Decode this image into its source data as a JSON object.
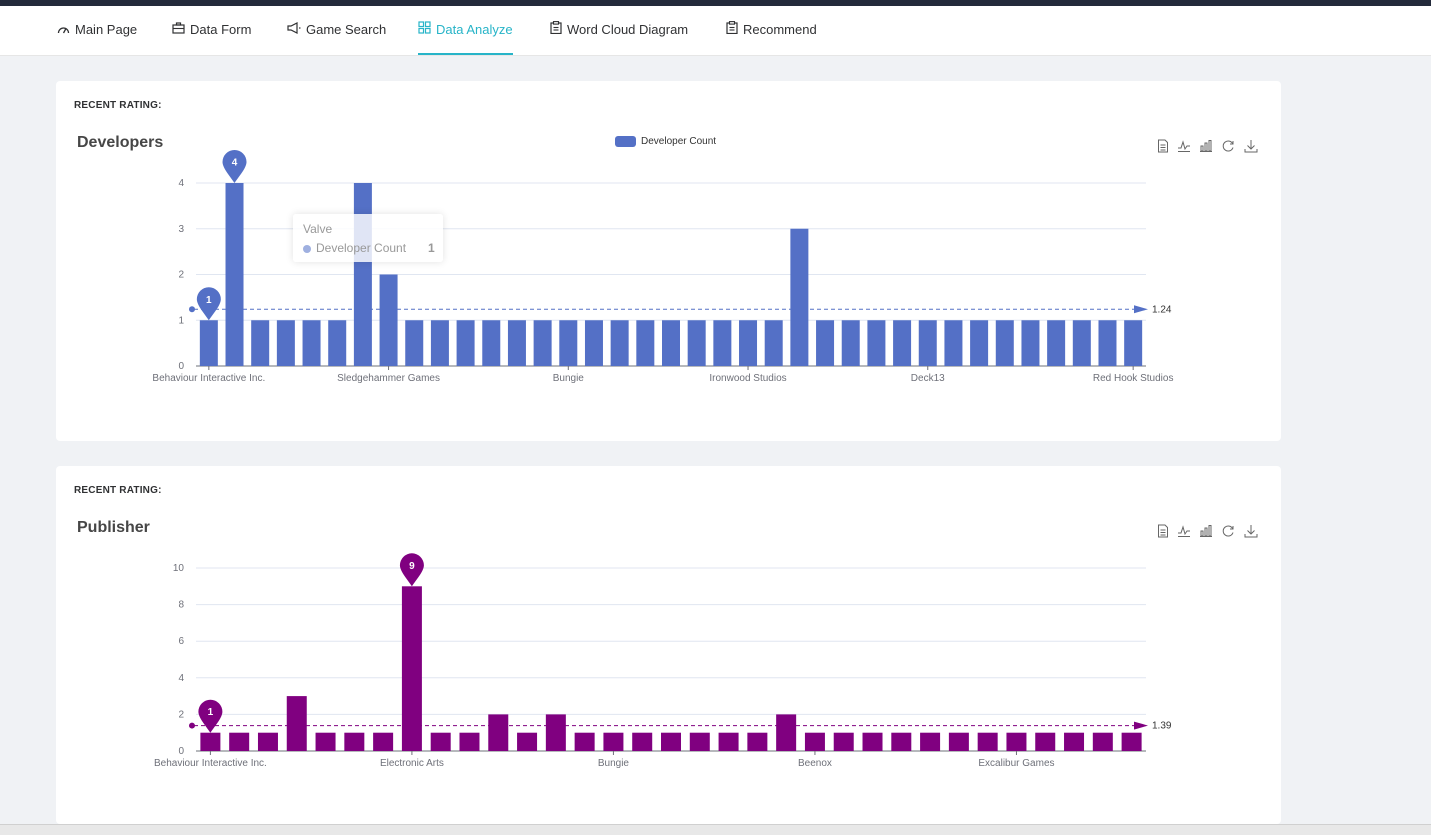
{
  "nav": {
    "items": [
      {
        "label": "Main Page",
        "icon": "dashboard-icon",
        "active": false
      },
      {
        "label": "Data Form",
        "icon": "briefcase-icon",
        "active": false
      },
      {
        "label": "Game Search",
        "icon": "megaphone-icon",
        "active": false
      },
      {
        "label": "Data Analyze",
        "icon": "grid-icon",
        "active": true
      },
      {
        "label": "Word Cloud Diagram",
        "icon": "clipboard-icon",
        "active": false
      },
      {
        "label": "Recommend",
        "icon": "clipboard-icon",
        "active": false
      }
    ],
    "active_color": "#27b4c8"
  },
  "cards": [
    {
      "label": "RECENT RATING:",
      "title": "Developers"
    },
    {
      "label": "RECENT RATING:",
      "title": "Publisher"
    }
  ],
  "toolbox": [
    "data-view-icon",
    "line-chart-icon",
    "bar-chart-icon",
    "restore-icon",
    "download-icon"
  ],
  "tooltip": {
    "title": "Valve",
    "series": "Developer Count",
    "value": "1"
  },
  "chart_data": [
    {
      "type": "bar",
      "title": "Developers",
      "legend": [
        "Developer Count"
      ],
      "legend_position": "top-center",
      "color": "#5470c6",
      "x_tick_labels": [
        "Behaviour Interactive Inc.",
        "Sledgehammer Games",
        "Bungie",
        "Ironwood Studios",
        "Deck13",
        "Red Hook Studios"
      ],
      "series": [
        {
          "name": "Developer Count",
          "values": [
            1,
            4,
            1,
            1,
            1,
            1,
            4,
            2,
            1,
            1,
            1,
            1,
            1,
            1,
            1,
            1,
            1,
            1,
            1,
            1,
            1,
            1,
            1,
            3,
            1,
            1,
            1,
            1,
            1,
            1,
            1,
            1,
            1,
            1,
            1,
            1,
            1
          ]
        }
      ],
      "ylim": [
        0,
        4
      ],
      "yticks": [
        0,
        1,
        2,
        3,
        4
      ],
      "markpoint_max": 4,
      "markpoint_min": 1,
      "average": 1.24,
      "grid": true
    },
    {
      "type": "bar",
      "title": "Publisher",
      "color": "#800080",
      "x_tick_labels": [
        "Behaviour Interactive Inc.",
        "Electronic Arts",
        "Bungie",
        "Beenox",
        "Excalibur Games"
      ],
      "series": [
        {
          "values": [
            1,
            1,
            1,
            3,
            1,
            1,
            1,
            9,
            1,
            1,
            2,
            1,
            2,
            1,
            1,
            1,
            1,
            1,
            1,
            1,
            2,
            1,
            1,
            1,
            1,
            1,
            1,
            1,
            1,
            1,
            1,
            1,
            1
          ]
        }
      ],
      "ylim": [
        0,
        10
      ],
      "yticks": [
        0,
        2,
        4,
        6,
        8,
        10
      ],
      "markpoint_max": 9,
      "markpoint_min": 1,
      "average": 1.39,
      "grid": true
    }
  ]
}
